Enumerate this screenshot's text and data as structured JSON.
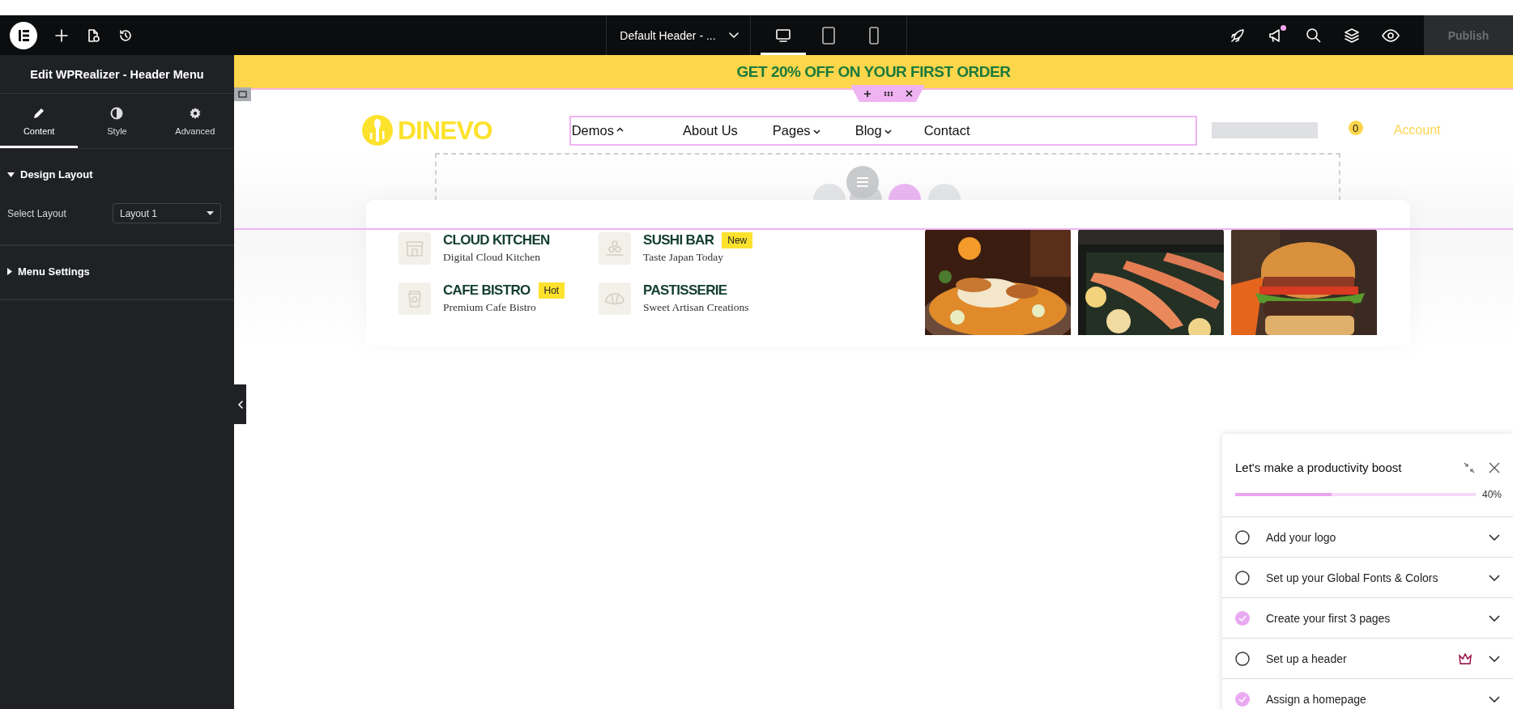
{
  "topbar": {
    "document_title": "Default Header - ...",
    "devices": [
      {
        "kind": "desktop",
        "selected": true
      },
      {
        "kind": "tablet",
        "selected": false
      },
      {
        "kind": "mobile",
        "selected": false
      }
    ],
    "announcements": {
      "unread": true
    },
    "publish": {
      "label": "Publish",
      "disabled": true
    }
  },
  "panel": {
    "title": "Edit WPRealizer - Header Menu",
    "tabs": [
      {
        "label": "Content",
        "selected": true
      },
      {
        "label": "Style",
        "selected": false
      },
      {
        "label": "Advanced",
        "selected": false
      }
    ],
    "sections": [
      {
        "title": "Design Layout",
        "expanded": true,
        "fields": [
          {
            "label": "Select Layout",
            "value": "Layout 1"
          }
        ]
      },
      {
        "title": "Menu Settings",
        "expanded": false
      }
    ]
  },
  "canvas": {
    "banner": "GET 20% OFF ON YOUR FIRST ORDER",
    "logo": "DINEVO",
    "nav": [
      {
        "label": "Demos",
        "has_submenu": true,
        "expanded": true
      },
      {
        "label": "About Us",
        "has_submenu": false
      },
      {
        "label": "Pages",
        "has_submenu": true,
        "expanded": false
      },
      {
        "label": "Blog",
        "has_submenu": true,
        "expanded": false
      },
      {
        "label": "Contact",
        "has_submenu": false
      }
    ],
    "cart_count": "0",
    "account": "Account",
    "mega_menu": {
      "items": [
        {
          "title": "CLOUD KITCHEN",
          "subtitle": "Digital Cloud Kitchen"
        },
        {
          "title": "SUSHI BAR",
          "badge": "New",
          "subtitle": "Taste Japan Today"
        },
        {
          "title": "CAFE BISTRO",
          "badge": "Hot",
          "subtitle": "Premium Cafe Bistro"
        },
        {
          "title": "PASTISSERIE",
          "subtitle": "Sweet Artisan Creations"
        }
      ]
    }
  },
  "checklist": {
    "title": "Let's make a productivity boost",
    "level": 0.4,
    "percent": "40%",
    "steps": [
      {
        "label": "Add your logo",
        "done": false,
        "premium": false
      },
      {
        "label": "Set up your Global Fonts & Colors",
        "done": false,
        "premium": false
      },
      {
        "label": "Create your first 3 pages",
        "done": true,
        "premium": false
      },
      {
        "label": "Set up a header",
        "done": false,
        "premium": true
      },
      {
        "label": "Assign a homepage",
        "done": true,
        "premium": false
      }
    ]
  }
}
